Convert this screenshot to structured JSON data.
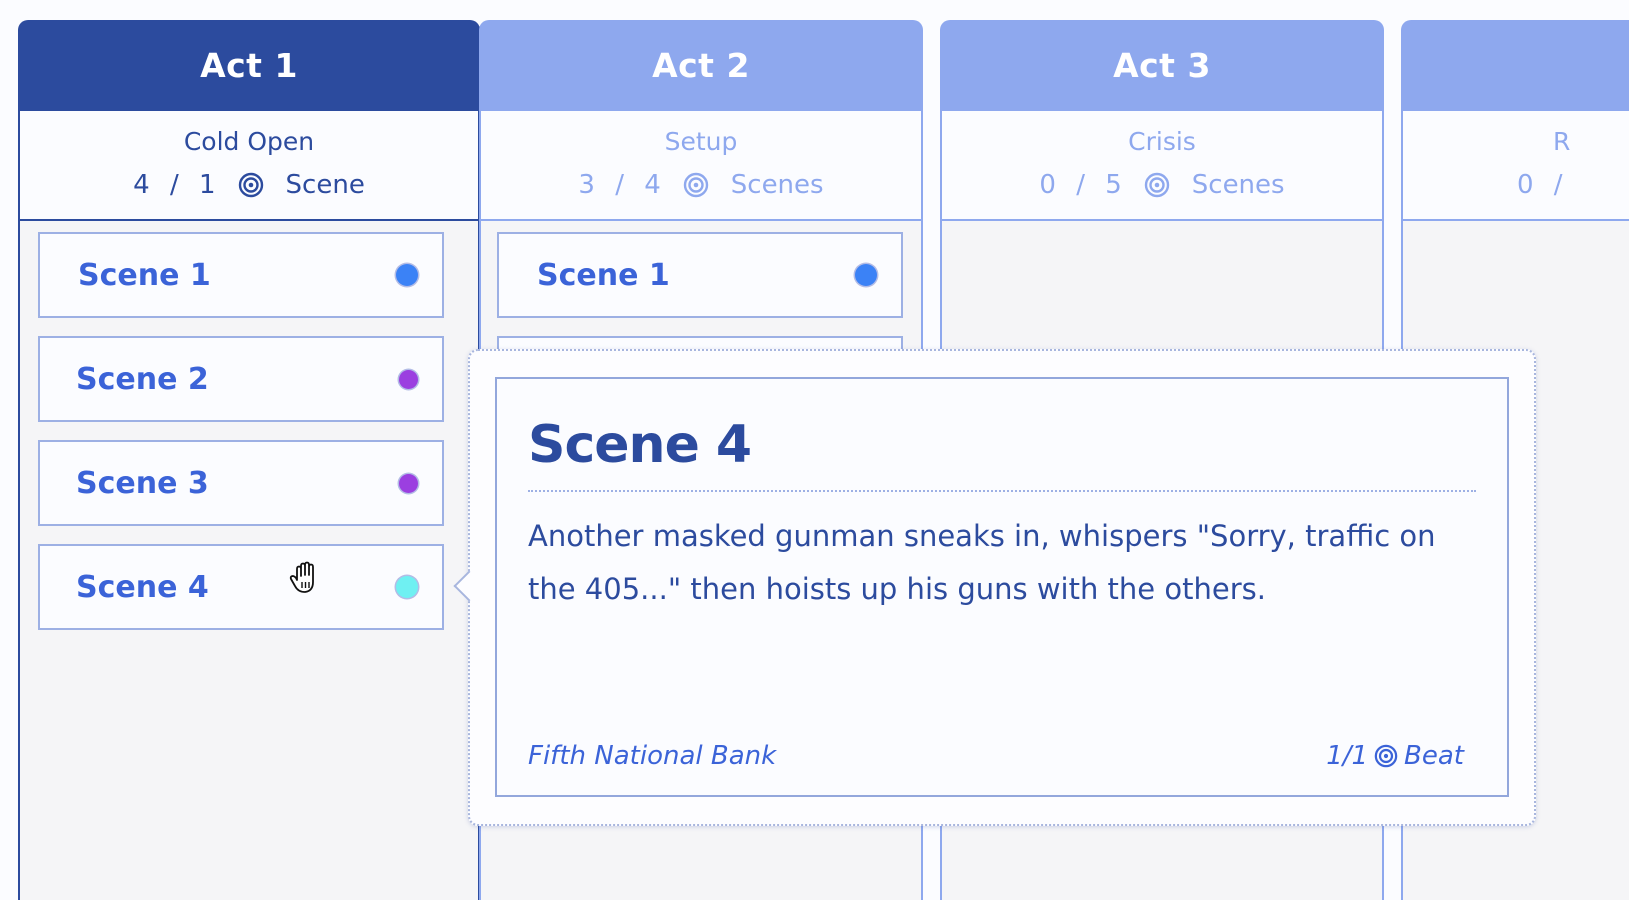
{
  "acts": [
    {
      "title": "Act 1",
      "subtitle": "Cold Open",
      "count": "4 / 1",
      "count_icon": "target-icon",
      "unit": "Scene",
      "state": "active",
      "scenes": [
        {
          "label": "Scene 1",
          "color": "#3b82f6"
        },
        {
          "label": "Scene 2",
          "color": "#9b3fe0"
        },
        {
          "label": "Scene 3",
          "color": "#9b3fe0"
        },
        {
          "label": "Scene 4",
          "color": "#6ff0f2"
        }
      ]
    },
    {
      "title": "Act 2",
      "subtitle": "Setup",
      "count": "3 / 4",
      "count_icon": "target-icon",
      "unit": "Scenes",
      "state": "inactive",
      "scenes": [
        {
          "label": "Scene 1",
          "color": "#3b82f6"
        }
      ]
    },
    {
      "title": "Act 3",
      "subtitle": "Crisis",
      "count": "0 / 5",
      "count_icon": "target-icon",
      "unit": "Scenes",
      "state": "inactive",
      "scenes": []
    },
    {
      "title": "",
      "subtitle": "R",
      "count": "0 /",
      "state": "inactive",
      "scenes": []
    }
  ],
  "popover": {
    "title": "Scene 4",
    "description": "Another masked gunman sneaks in, whispers \"Sorry, traffic on the 405...\" then hoists up his guns with the others.",
    "location": "Fifth National Bank",
    "beat_count": "1/1",
    "beat_icon": "target-icon",
    "beat_label": "Beat"
  },
  "colors": {
    "active": "#2c4b9e",
    "inactive": "#8ea8ee",
    "scene_text": "#3b63d8"
  }
}
